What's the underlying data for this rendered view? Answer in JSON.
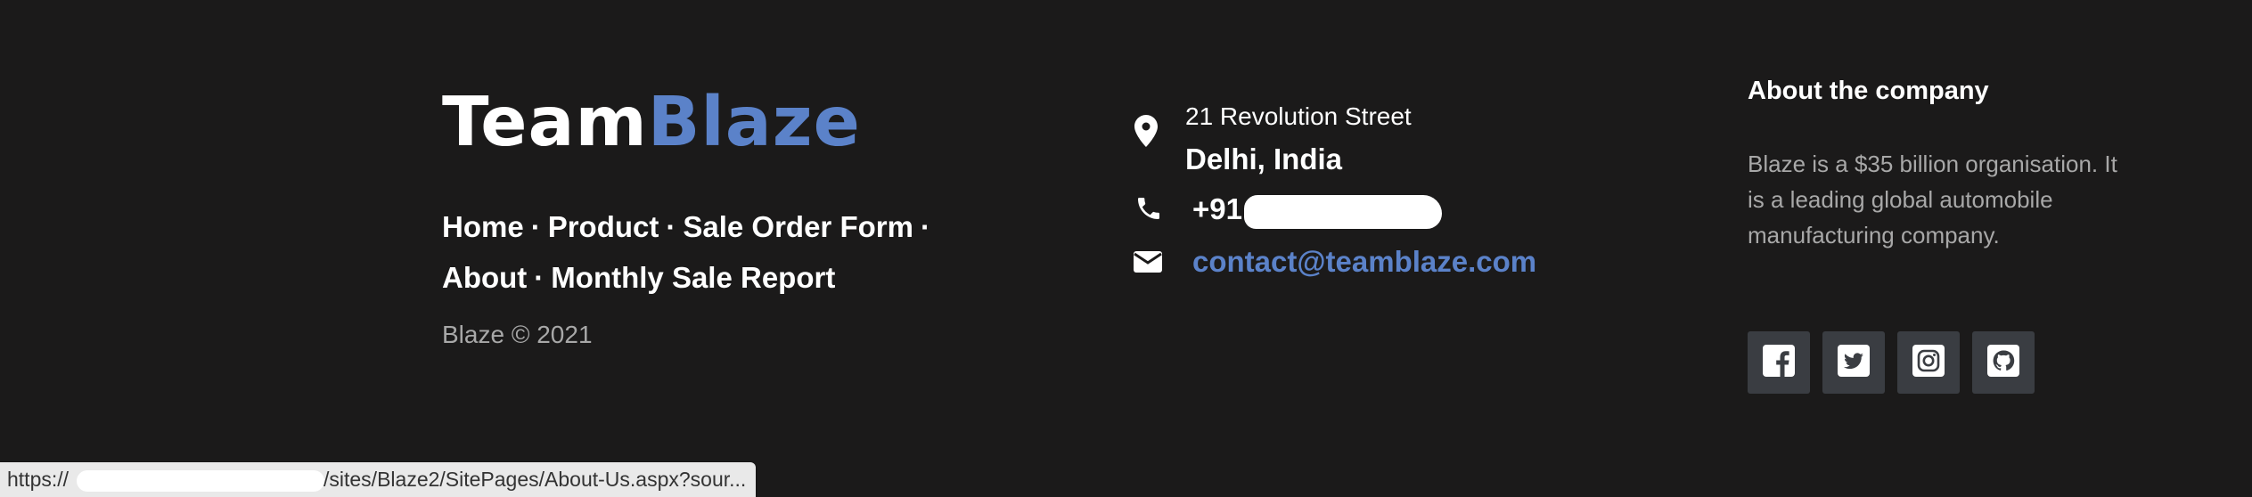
{
  "brand": {
    "team": "Team",
    "blaze": "Blaze"
  },
  "nav": {
    "items": [
      "Home",
      "Product",
      "Sale Order Form",
      "About",
      "Monthly Sale Report"
    ],
    "separator": "·"
  },
  "copyright": "Blaze © 2021",
  "contact": {
    "street": "21 Revolution Street",
    "city": "Delhi, India",
    "phone_prefix": "+91",
    "email": "contact@teamblaze.com"
  },
  "about": {
    "title": "About the company",
    "text": "Blaze is a $35 billion organisation. It is a leading global automobile manufacturing company."
  },
  "socials": [
    "facebook-icon",
    "twitter-icon",
    "instagram-icon",
    "github-icon"
  ],
  "status_bar": {
    "prefix": "https://",
    "path": "/sites/Blaze2/SitePages/About-Us.aspx?sour..."
  },
  "colors": {
    "background": "#1b1a1a",
    "accent": "#5b82c9",
    "muted": "#a8a8a8",
    "social_bg": "#3a3d42"
  }
}
